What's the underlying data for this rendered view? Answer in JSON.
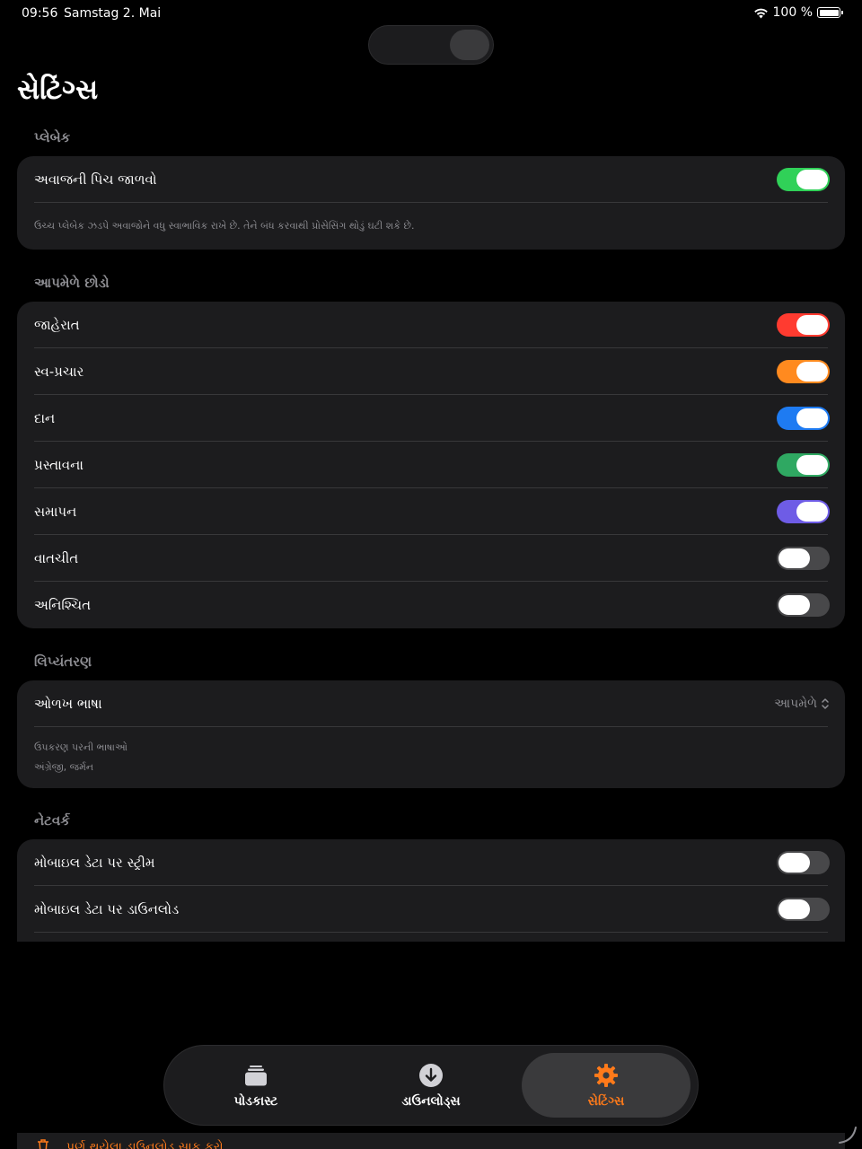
{
  "status_bar": {
    "time": "09:56",
    "date": "Samstag 2. Mai",
    "battery": "100 %"
  },
  "page": {
    "title": "સેટિંગ્સ"
  },
  "playback": {
    "header": "પ્લેબેક",
    "pitch_label": "અવાજની પિચ જાળવો",
    "pitch_on": true,
    "pitch_footnote": "ઉચ્ચ પ્લેબેક ઝડપે અવાજોને વધુ સ્વાભાવિક રાખે છે. તેને બંધ કરવાથી પ્રોસેસિંગ થોડું ઘટી શકે છે.",
    "toggle_color": "#30d158"
  },
  "auto_skip": {
    "header": "આપમેળે છોડો",
    "items": [
      {
        "label": "જાહેરાત",
        "on": true,
        "color": "#ff3b30"
      },
      {
        "label": "સ્વ-પ્રચાર",
        "on": true,
        "color": "#ff8a1f"
      },
      {
        "label": "દાન",
        "on": true,
        "color": "#1e7bf2"
      },
      {
        "label": "પ્રસ્તાવના",
        "on": true,
        "color": "#2fa862"
      },
      {
        "label": "સમાપન",
        "on": true,
        "color": "#6e5ce6"
      },
      {
        "label": "વાતચીત",
        "on": false,
        "color": "#48484a"
      },
      {
        "label": "અનિશ્ચિત",
        "on": false,
        "color": "#48484a"
      }
    ]
  },
  "transcription": {
    "header": "લિપ્યંતરણ",
    "language_label": "ઓળખ ભાષા",
    "language_value": "આપમેળે",
    "device_languages_title": "ઉપકરણ પરની ભાષાઓ",
    "device_languages": "અંગ્રેજી, જર્મન"
  },
  "network": {
    "header": "નેટવર્ક",
    "items": [
      {
        "label": "મોબાઇલ ડેટા પર સ્ટ્રીમ",
        "on": false
      },
      {
        "label": "મોબાઇલ ડેટા પર ડાઉનલોડ",
        "on": false
      }
    ]
  },
  "tabbar": {
    "tabs": [
      {
        "label": "પોડકાસ્ટ",
        "icon": "stack-icon",
        "active": false
      },
      {
        "label": "ડાઉનલોડ્સ",
        "icon": "download-circle-icon",
        "active": false
      },
      {
        "label": "સેટિંગ્સ",
        "icon": "gear-icon",
        "active": true
      }
    ],
    "accent": "#ff7a1a"
  },
  "bottom_action": {
    "label": "પૂર્ણ થયેલા ડાઉનલોડ સાફ કરો"
  }
}
